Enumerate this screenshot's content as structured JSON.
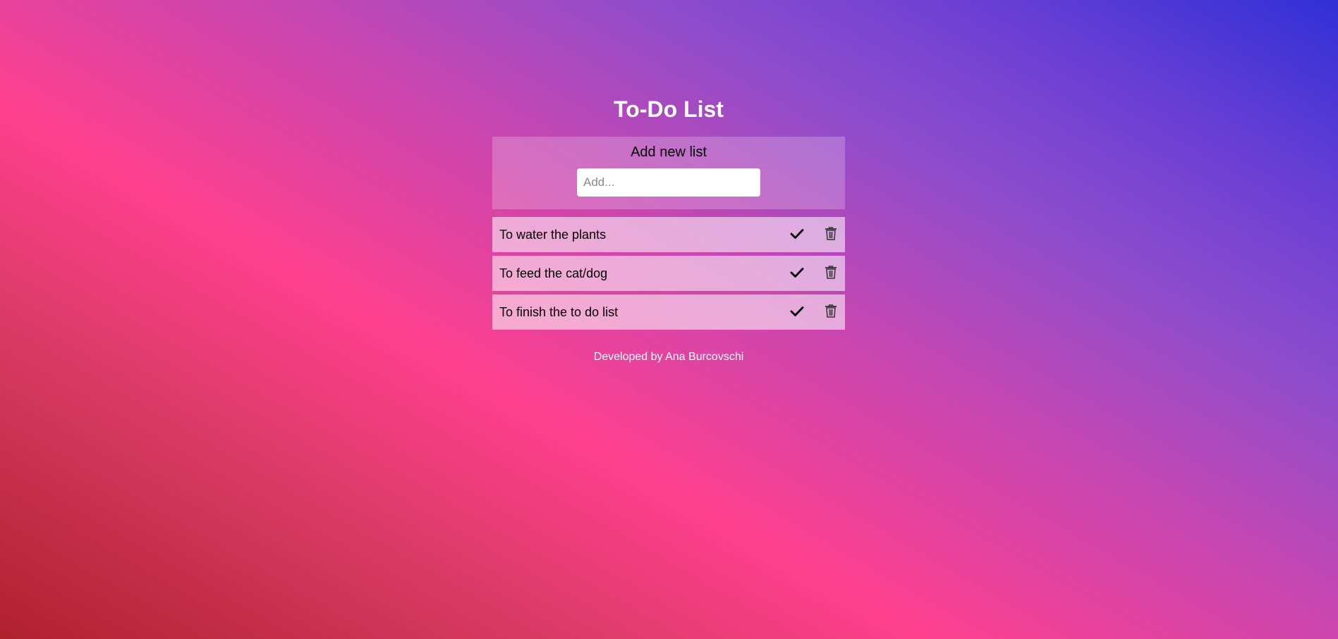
{
  "app": {
    "title": "To-Do List"
  },
  "add_panel": {
    "heading": "Add new list",
    "input_value": "",
    "input_placeholder": "Add..."
  },
  "todos": [
    {
      "text": "To water the plants",
      "check_icon": "checkmark-icon",
      "delete_icon": "trash-icon"
    },
    {
      "text": "To feed the cat/dog",
      "check_icon": "checkmark-icon",
      "delete_icon": "trash-icon"
    },
    {
      "text": "To finish the to do list",
      "check_icon": "checkmark-icon",
      "delete_icon": "trash-icon"
    }
  ],
  "footer": {
    "text": "Developed by Ana Burcovschi"
  },
  "colors": {
    "title_text": "#ffffff",
    "gradient_start": "#b0212e",
    "gradient_mid": "#ff408e",
    "gradient_end": "#3030d6"
  }
}
